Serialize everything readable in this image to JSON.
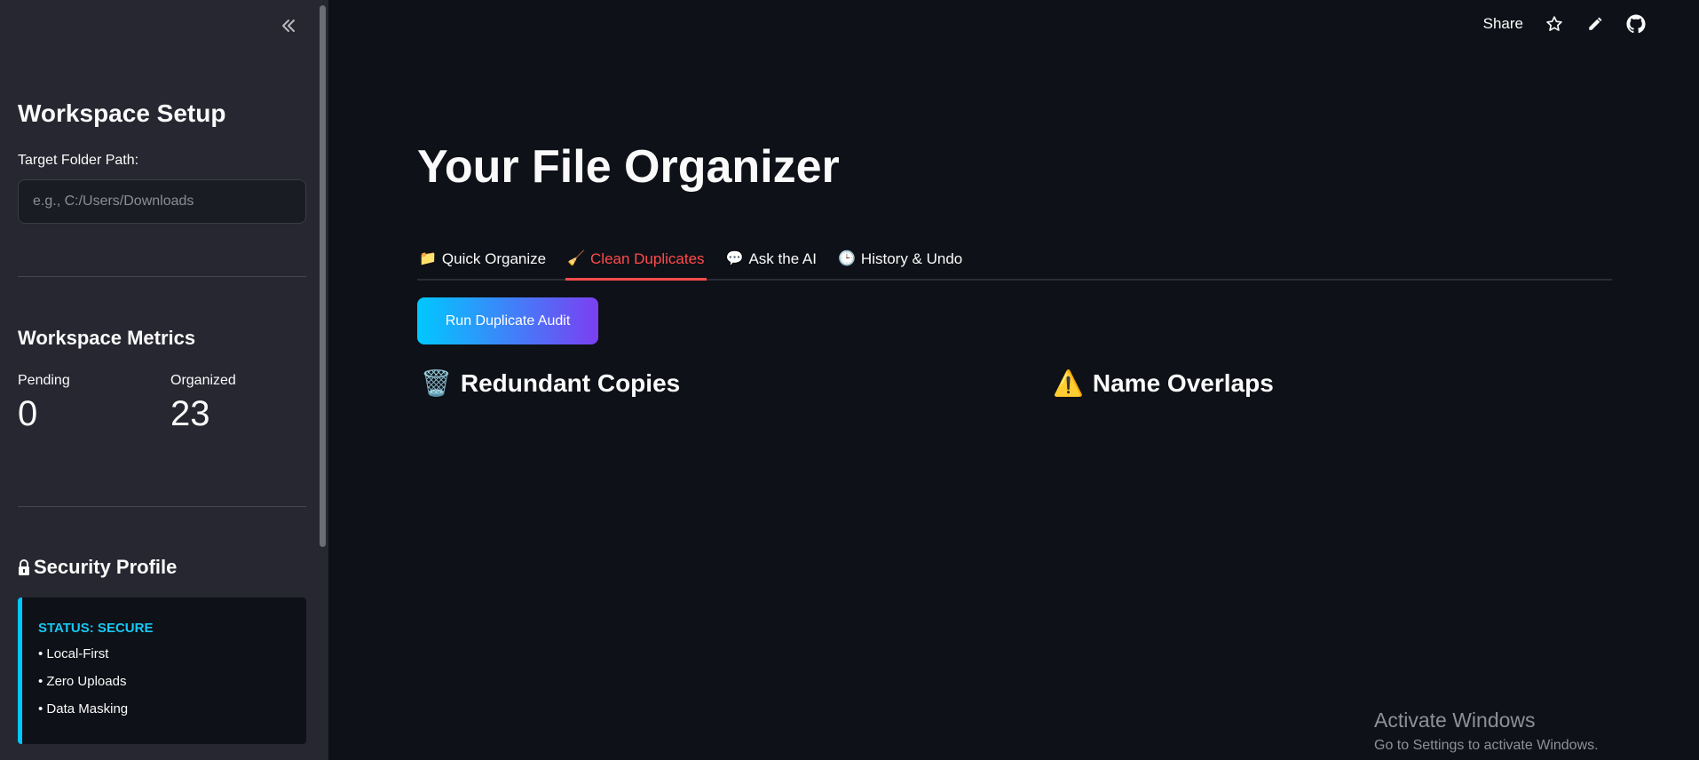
{
  "sidebar": {
    "collapse_glyph": "«",
    "workspace_setup": {
      "heading": "Workspace Setup",
      "folder_label": "Target Folder Path:",
      "folder_value": "",
      "folder_placeholder": "e.g., C:/Users/Downloads"
    },
    "metrics": {
      "heading": "Workspace Metrics",
      "pending_label": "Pending",
      "pending_value": "0",
      "organized_label": "Organized",
      "organized_value": "23"
    },
    "security": {
      "icon": "lock-icon",
      "heading": "Security Profile",
      "status": "STATUS: SECURE",
      "items": [
        "• Local-First",
        "• Zero Uploads",
        "• Data Masking"
      ],
      "accent_color": "#00c8ff"
    }
  },
  "topbar": {
    "share_label": "Share",
    "icons": [
      "star-icon",
      "pencil-icon",
      "github-icon"
    ]
  },
  "main": {
    "title": "Your File Organizer",
    "tabs": [
      {
        "icon": "📁",
        "label": "Quick Organize",
        "active": false
      },
      {
        "icon": "🧹",
        "label": "Clean Duplicates",
        "active": true
      },
      {
        "icon": "💬",
        "label": "Ask the AI",
        "active": false
      },
      {
        "icon": "🕒",
        "label": "History & Undo",
        "active": false
      }
    ],
    "audit_button_label": "Run Duplicate Audit",
    "sections": [
      {
        "icon": "🗑️",
        "title": "Redundant Copies"
      },
      {
        "icon": "⚠️",
        "title": "Name Overlaps"
      }
    ],
    "active_tab_color": "#ff4b4b"
  },
  "watermark": {
    "title": "Activate Windows",
    "subtitle": "Go to Settings to activate Windows."
  }
}
